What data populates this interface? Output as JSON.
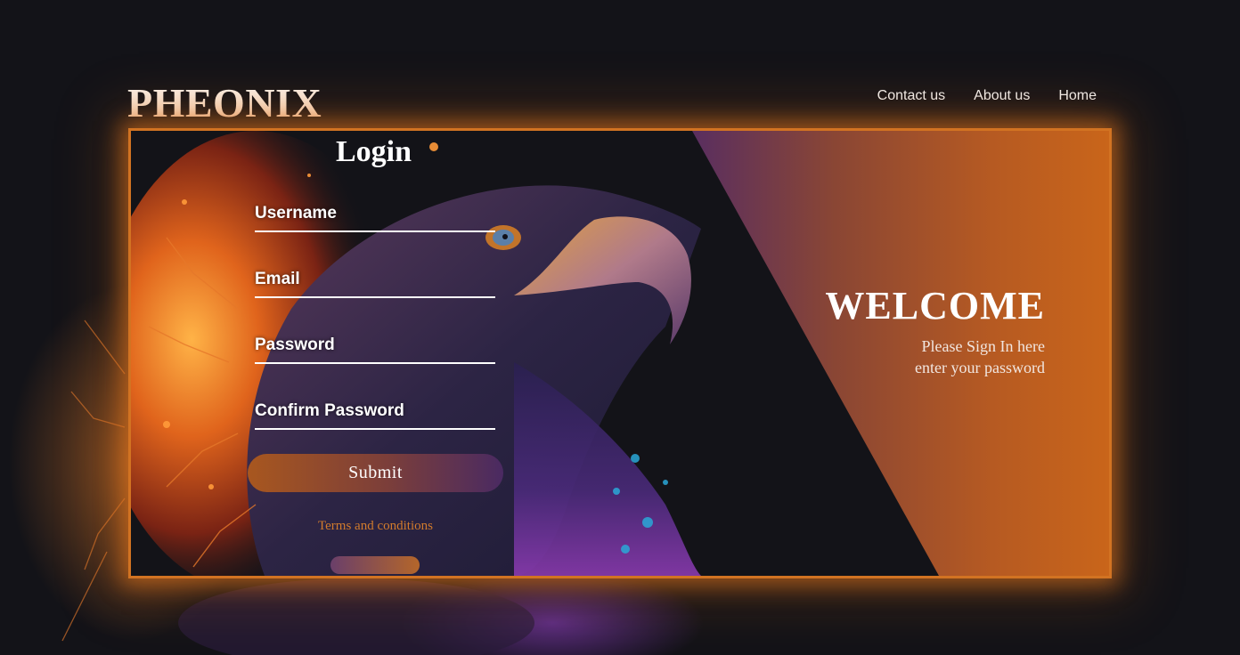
{
  "header": {
    "brand": "PHEONIX",
    "nav": [
      "Contact us",
      "About us",
      "Home"
    ]
  },
  "login": {
    "title": "Login",
    "fields": [
      {
        "label": "Username"
      },
      {
        "label": "Email"
      },
      {
        "label": "Password"
      },
      {
        "label": "Confirm Password"
      }
    ],
    "submit_label": "Submit",
    "terms_link": "Terms and conditions"
  },
  "welcome": {
    "title": "WELCOME",
    "line1": "Please Sign In here",
    "line2": "enter your password"
  },
  "colors": {
    "background": "#131318",
    "accent_orange": "#d27322",
    "accent_purple": "#3a2b6e",
    "terms_link": "#d27b2c"
  },
  "icons": [
    "eagle-illustration"
  ]
}
